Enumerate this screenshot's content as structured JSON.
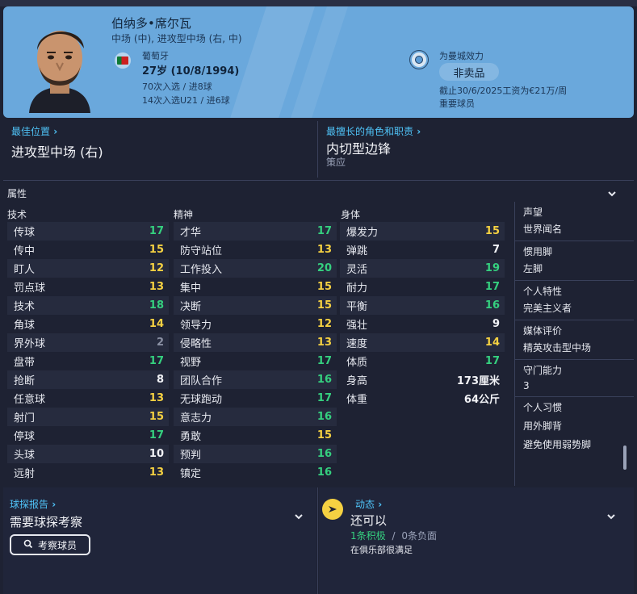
{
  "header": {
    "name": "伯纳多•席尔瓦",
    "positions": "中场 (中), 进攻型中场 (右, 中)",
    "nationality": "葡萄牙",
    "age_dob": "27岁 (10/8/1994)",
    "caps": "70次入选 / 进8球",
    "u21": "14次入选U21 / 进6球",
    "club_label": "为曼城效力",
    "transfer_status": "非卖品",
    "contract": "截止30/6/2025工资为€21万/周",
    "squad_status": "重要球员"
  },
  "best_position": {
    "link": "最佳位置",
    "value": "进攻型中场 (右)"
  },
  "best_role": {
    "link": "最擅长的角色和职责",
    "value": "内切型边锋",
    "duty": "策应"
  },
  "attributes": {
    "title": "属性",
    "technical": {
      "header": "技术",
      "items": [
        {
          "label": "传球",
          "value": "17"
        },
        {
          "label": "传中",
          "value": "15"
        },
        {
          "label": "盯人",
          "value": "12"
        },
        {
          "label": "罚点球",
          "value": "13"
        },
        {
          "label": "技术",
          "value": "18"
        },
        {
          "label": "角球",
          "value": "14"
        },
        {
          "label": "界外球",
          "value": "2"
        },
        {
          "label": "盘带",
          "value": "17"
        },
        {
          "label": "抢断",
          "value": "8"
        },
        {
          "label": "任意球",
          "value": "13"
        },
        {
          "label": "射门",
          "value": "15"
        },
        {
          "label": "停球",
          "value": "17"
        },
        {
          "label": "头球",
          "value": "10"
        },
        {
          "label": "远射",
          "value": "13"
        }
      ]
    },
    "mental": {
      "header": "精神",
      "items": [
        {
          "label": "才华",
          "value": "17"
        },
        {
          "label": "防守站位",
          "value": "13"
        },
        {
          "label": "工作投入",
          "value": "20"
        },
        {
          "label": "集中",
          "value": "15"
        },
        {
          "label": "决断",
          "value": "15"
        },
        {
          "label": "领导力",
          "value": "12"
        },
        {
          "label": "侵略性",
          "value": "13"
        },
        {
          "label": "视野",
          "value": "17"
        },
        {
          "label": "团队合作",
          "value": "16"
        },
        {
          "label": "无球跑动",
          "value": "17"
        },
        {
          "label": "意志力",
          "value": "16"
        },
        {
          "label": "勇敢",
          "value": "15"
        },
        {
          "label": "预判",
          "value": "16"
        },
        {
          "label": "镇定",
          "value": "16"
        }
      ]
    },
    "physical": {
      "header": "身体",
      "items": [
        {
          "label": "爆发力",
          "value": "15"
        },
        {
          "label": "弹跳",
          "value": "7"
        },
        {
          "label": "灵活",
          "value": "19"
        },
        {
          "label": "耐力",
          "value": "17"
        },
        {
          "label": "平衡",
          "value": "16"
        },
        {
          "label": "强壮",
          "value": "9"
        },
        {
          "label": "速度",
          "value": "14"
        },
        {
          "label": "体质",
          "value": "17"
        }
      ],
      "height_label": "身高",
      "height_value": "173厘米",
      "weight_label": "体重",
      "weight_value": "64公斤"
    }
  },
  "info": {
    "reputation_label": "声望",
    "reputation_value": "世界闻名",
    "foot_label": "惯用脚",
    "foot_value": "左脚",
    "traits_label": "个人特性",
    "traits_value": "完美主义者",
    "media_label": "媒体评价",
    "media_value": "精英攻击型中场",
    "defensive_label": "守门能力",
    "defensive_value": "3",
    "habits_label": "个人习惯",
    "habits_1": "用外脚背",
    "habits_2": "避免使用弱势脚"
  },
  "scout": {
    "link": "球探报告",
    "value": "需要球探考察",
    "button": "考察球员"
  },
  "dynamics": {
    "link": "动态",
    "value": "还可以",
    "positive": "1条积极",
    "separator": "/",
    "negative": "0条负面",
    "note": "在俱乐部很满足"
  },
  "colors": {
    "header_bg": "#6aa8dc",
    "link": "#4fc3f7",
    "yellow": "#f5d142",
    "green": "#35d07f",
    "light_green": "#9be05a",
    "grey": "#8a90a3"
  }
}
